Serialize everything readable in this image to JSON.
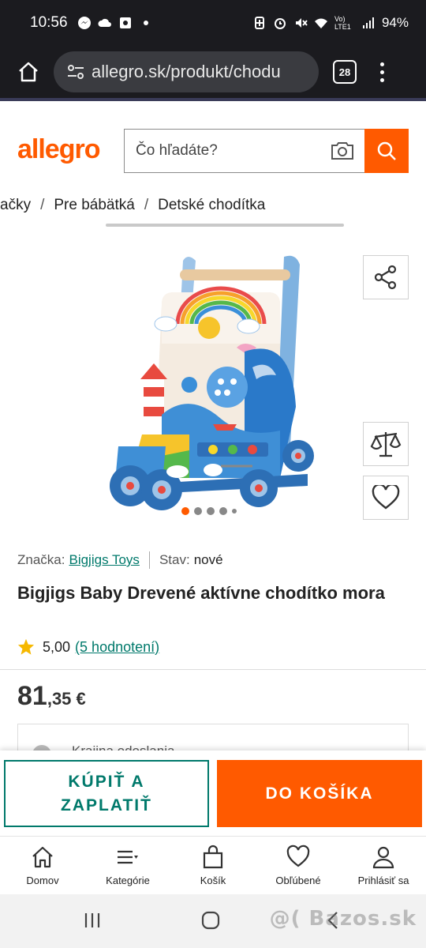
{
  "status_bar": {
    "time": "10:56",
    "battery": "94%",
    "network": "Vo) LTE1"
  },
  "browser": {
    "url": "allegro.sk/produkt/chodu",
    "tab_count": "28"
  },
  "header": {
    "logo": "allegro",
    "search_placeholder": "Čo hľadáte?"
  },
  "breadcrumb": {
    "items": [
      "ačky",
      "Pre bábätká",
      "Detské chodítka"
    ],
    "separator": "/"
  },
  "gallery": {
    "image_count": 5,
    "active_index": 0
  },
  "product": {
    "brand_label": "Značka:",
    "brand": "Bigjigs Toys",
    "condition_label": "Stav:",
    "condition": "nové",
    "title": "Bigjigs Baby Drevené aktívne chodítko mora",
    "rating": "5,00",
    "reviews": "(5 hodnotení)",
    "price_main": "81",
    "price_cents": ",35 €",
    "shipping_label": "Krajina odoslania"
  },
  "actions": {
    "buy_now": "KÚPIŤ A ZAPLATIŤ",
    "add_to_cart": "DO KOŠÍKA"
  },
  "bottom_nav": {
    "items": [
      "Domov",
      "Kategórie",
      "Košík",
      "Obľúbené",
      "Prihlásiť sa"
    ]
  },
  "watermark": "@( Bazos.sk",
  "colors": {
    "brand": "#ff5a00",
    "link": "#00796b",
    "dark": "#1b1b1f"
  }
}
